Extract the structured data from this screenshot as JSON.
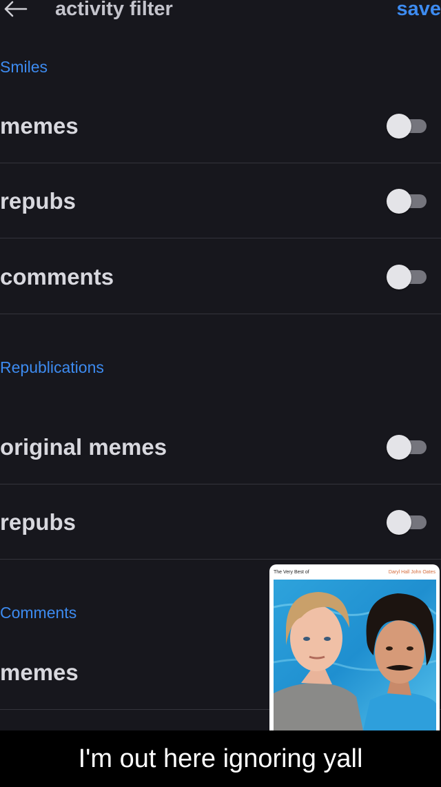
{
  "header": {
    "back_icon": "arrow-left-icon",
    "title": "activity filter",
    "save_label": "save"
  },
  "colors": {
    "background": "#17171d",
    "accent": "#3d8bf0",
    "divider": "#34343c",
    "toggle_track_off": "#75757d",
    "toggle_knob": "#e4e4e8"
  },
  "sections": [
    {
      "title": "Smiles",
      "rows": [
        {
          "label": "memes",
          "enabled": false
        },
        {
          "label": "repubs",
          "enabled": false
        },
        {
          "label": "comments",
          "enabled": false
        }
      ]
    },
    {
      "title": "Republications",
      "rows": [
        {
          "label": "original memes",
          "enabled": false
        },
        {
          "label": "repubs",
          "enabled": false
        }
      ]
    },
    {
      "title": "Comments",
      "rows": [
        {
          "label": "memes"
        }
      ]
    }
  ],
  "album": {
    "title_text": "The Very Best of",
    "artists_text": "Daryl Hall  John Oates"
  },
  "caption": "I'm out here ignoring yall"
}
